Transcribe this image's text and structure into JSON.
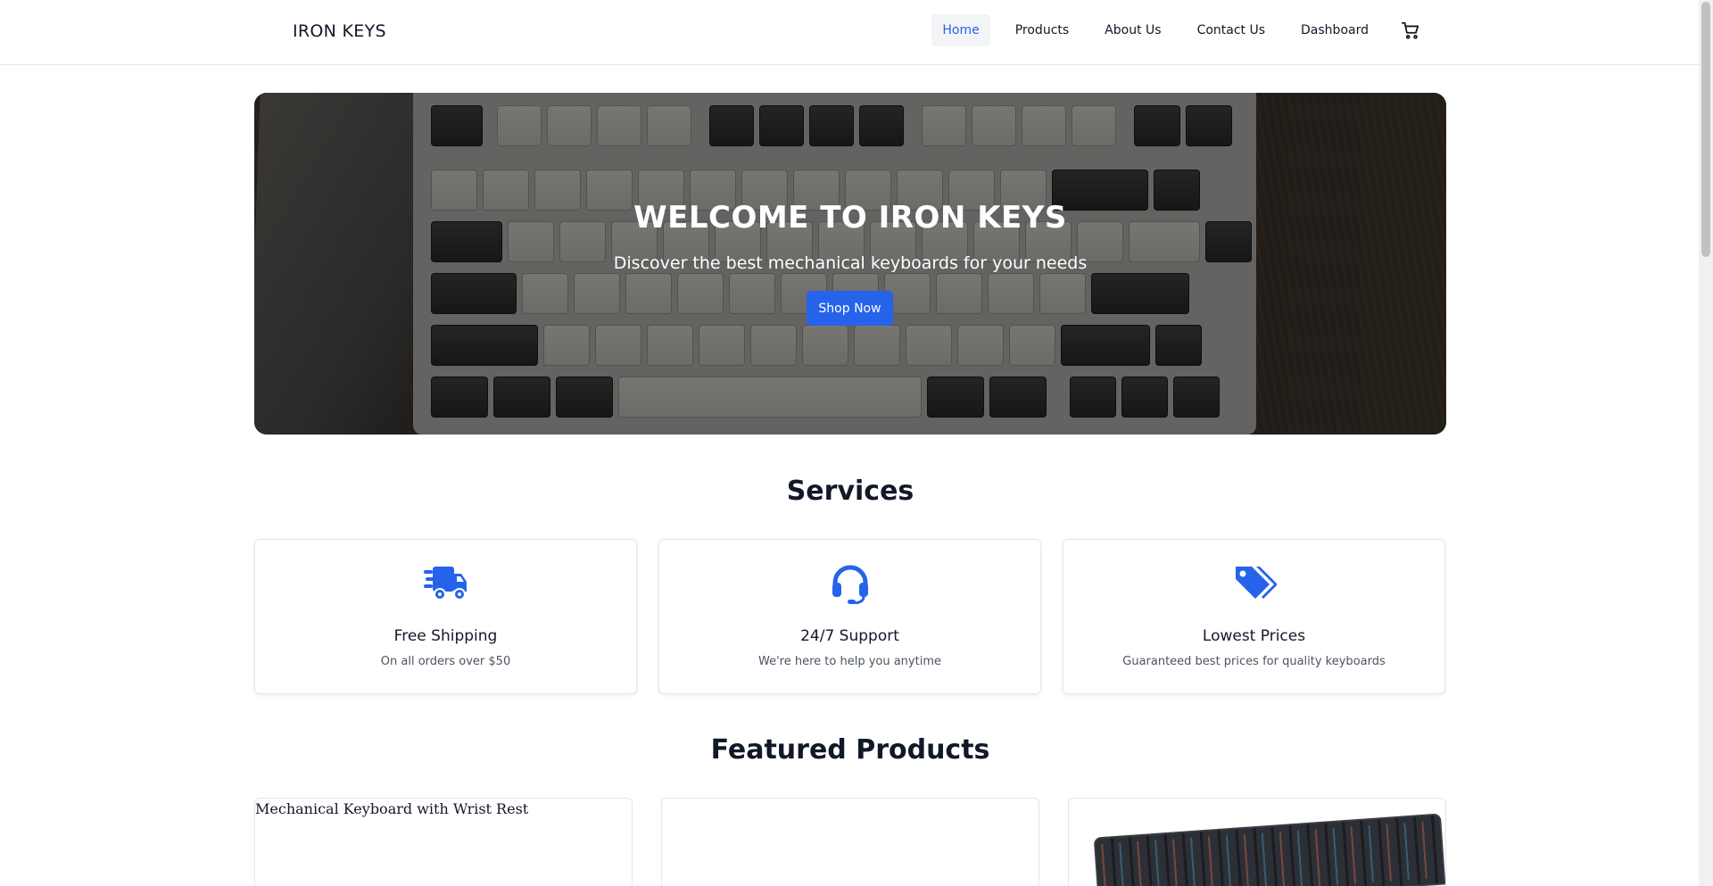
{
  "brand": "IRON KEYS",
  "nav": {
    "links": [
      "Home",
      "Products",
      "About Us",
      "Contact Us",
      "Dashboard"
    ],
    "active": "Home",
    "cart_icon": "cart-icon"
  },
  "hero": {
    "title": "WELCOME TO IRON KEYS",
    "subtitle": "Discover the best mechanical keyboards for your needs",
    "cta": "Shop Now"
  },
  "services": {
    "heading": "Services",
    "items": [
      {
        "icon": "truck-fast-icon",
        "title": "Free Shipping",
        "desc": "On all orders over $50"
      },
      {
        "icon": "headset-icon",
        "title": "24/7 Support",
        "desc": "We're here to help you anytime"
      },
      {
        "icon": "tags-icon",
        "title": "Lowest Prices",
        "desc": "Guaranteed best prices for quality keyboards"
      }
    ]
  },
  "featured": {
    "heading": "Featured Products",
    "products": [
      {
        "alt": "Mechanical Keyboard with Wrist Rest"
      },
      {
        "alt": ""
      },
      {
        "alt": ""
      }
    ]
  },
  "colors": {
    "accent": "#2563eb",
    "text": "#111827",
    "muted": "#4b5563",
    "border": "#e5e7eb"
  }
}
